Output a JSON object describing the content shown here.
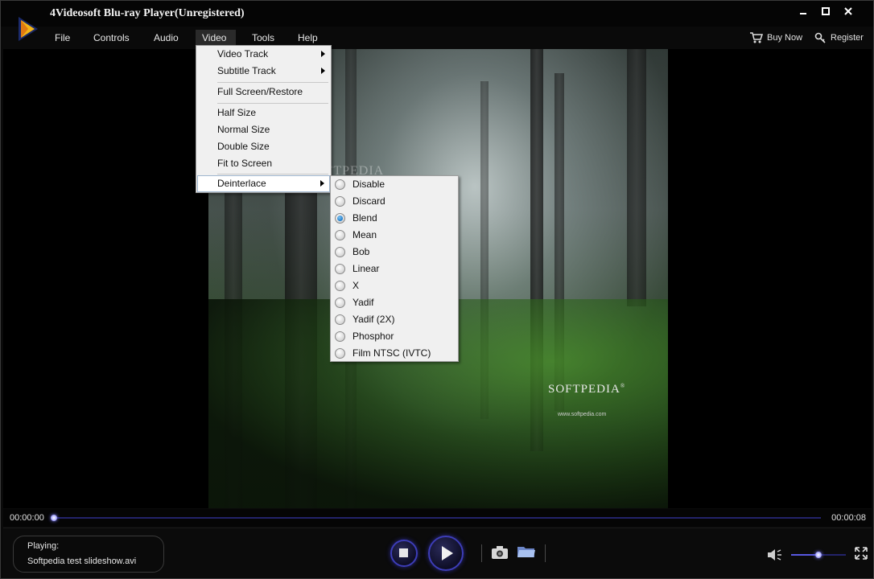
{
  "window": {
    "title": "4Videosoft Blu-ray Player(Unregistered)",
    "controls": {
      "minimize": "✖",
      "maximize": "□",
      "close": "✕"
    }
  },
  "menubar": {
    "items": [
      {
        "label": "File"
      },
      {
        "label": "Controls"
      },
      {
        "label": "Audio"
      },
      {
        "label": "Video"
      },
      {
        "label": "Tools"
      },
      {
        "label": "Help"
      }
    ],
    "active": "Video"
  },
  "header_links": {
    "buy_now": "Buy Now",
    "register": "Register"
  },
  "video_menu": {
    "items": [
      {
        "label": "Video Track",
        "submenu": true
      },
      {
        "label": "Subtitle Track",
        "submenu": true
      },
      {
        "label": "Full Screen/Restore"
      },
      {
        "label": "Half Size"
      },
      {
        "label": "Normal Size"
      },
      {
        "label": "Double Size"
      },
      {
        "label": "Fit to Screen"
      },
      {
        "label": "Deinterlace",
        "submenu": true,
        "highlighted": true
      }
    ]
  },
  "deinterlace_menu": {
    "items": [
      {
        "label": "Disable"
      },
      {
        "label": "Discard"
      },
      {
        "label": "Blend",
        "checked": true
      },
      {
        "label": "Mean"
      },
      {
        "label": "Bob"
      },
      {
        "label": "Linear"
      },
      {
        "label": "X"
      },
      {
        "label": "Yadif"
      },
      {
        "label": "Yadif (2X)"
      },
      {
        "label": "Phosphor"
      },
      {
        "label": "Film NTSC (IVTC)"
      }
    ],
    "selected": "Blend"
  },
  "video": {
    "watermark": "SOFTPEDIA",
    "watermark_mark": "®",
    "watermark_url": "www.softpedia.com"
  },
  "playback": {
    "current_time": "00:00:00",
    "total_time": "00:00:08",
    "progress": 0.0,
    "playing_label": "Playing:",
    "file_name": "Softpedia test slideshow.avi",
    "volume": 0.5
  },
  "icons": {
    "stop": "stop-icon",
    "play": "play-icon",
    "snapshot": "camera-icon",
    "open": "folder-icon",
    "volume": "speaker-icon",
    "fullscreen": "fullscreen-icon"
  },
  "colors": {
    "accent": "#3d3db8",
    "seek_track": "#23236a",
    "menu_bg": "#f0f0f0",
    "radio_checked": "#1f7ccb"
  }
}
